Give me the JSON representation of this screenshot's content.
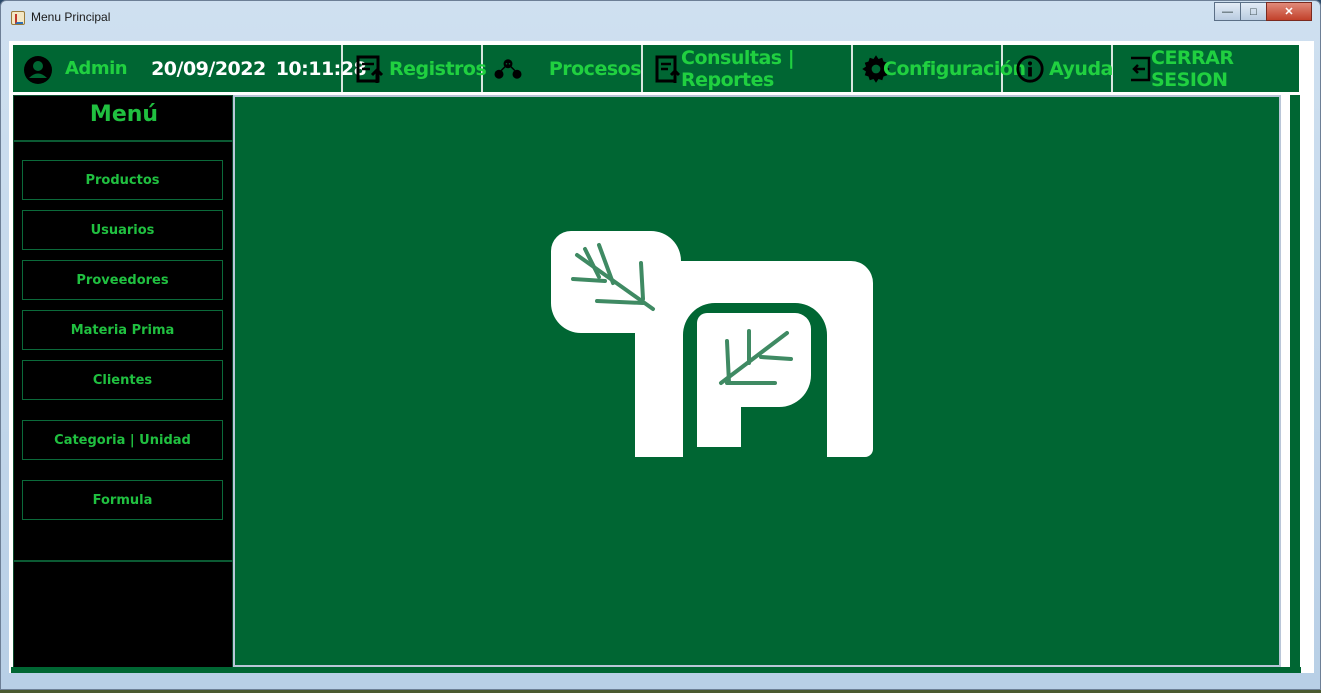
{
  "window": {
    "title": "Menu Principal",
    "minimize": "—",
    "maximize": "□",
    "close": "✕"
  },
  "topbar": {
    "user": "Admin",
    "date": "20/09/2022",
    "time": "10:11:28",
    "items": [
      {
        "label": "Registros",
        "icon": "document-upload-icon"
      },
      {
        "label": "Procesos",
        "icon": "process-network-icon"
      },
      {
        "label": "Consultas | Reportes",
        "icon": "report-icon"
      },
      {
        "label": "Configuración",
        "icon": "gear-icon"
      },
      {
        "label": "Ayuda",
        "icon": "info-icon"
      },
      {
        "label": "CERRAR SESION",
        "icon": "logout-icon"
      }
    ]
  },
  "sidebar": {
    "title": "Menú",
    "items": [
      {
        "label": "Productos"
      },
      {
        "label": "Usuarios"
      },
      {
        "label": "Proveedores"
      },
      {
        "label": "Materia Prima"
      },
      {
        "label": "Clientes"
      },
      {
        "label": "Categoria | Unidad"
      },
      {
        "label": "Formula"
      }
    ]
  },
  "colors": {
    "primary": "#006633",
    "accent": "#20d040",
    "sidebar": "#000000",
    "logo": "#ffffff",
    "logo_leaf": "#3f8a63"
  }
}
